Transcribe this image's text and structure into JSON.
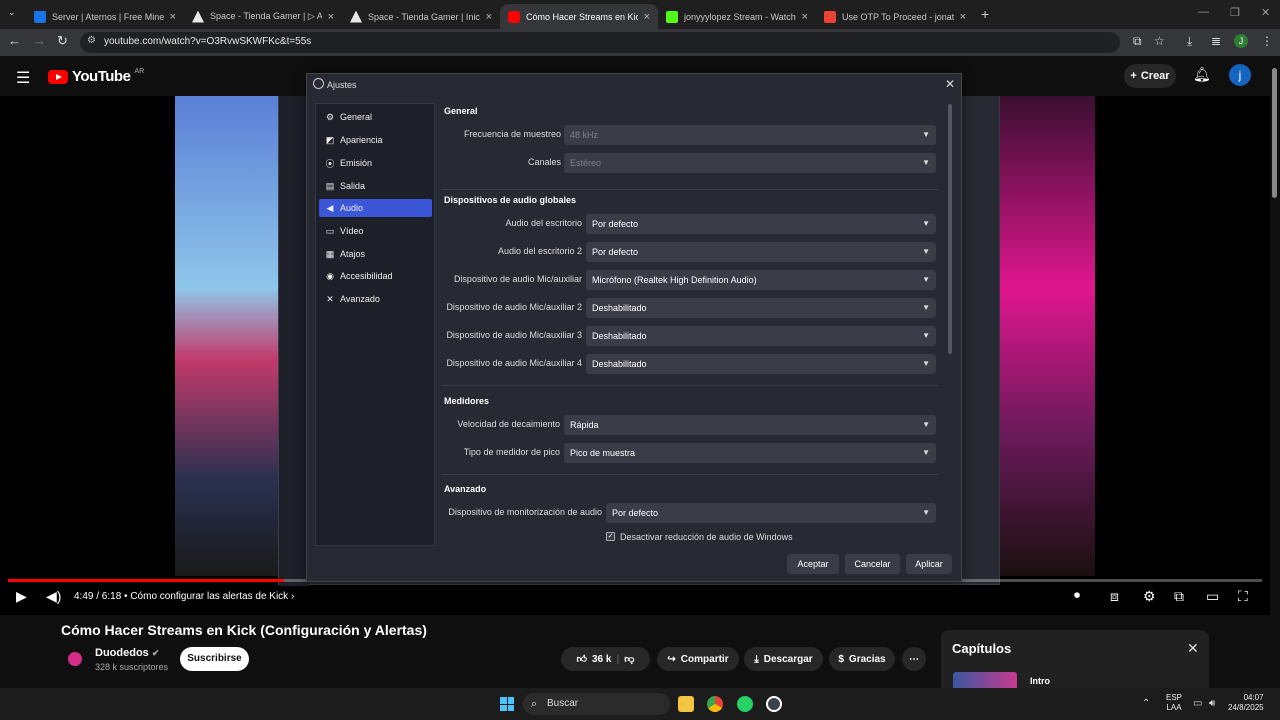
{
  "browser": {
    "tabs": [
      {
        "title": "Server | Aternos | Free Minecraft",
        "fav": "#1a73e8"
      },
      {
        "title": "Space - Tienda Gamer | ▷ Aquí",
        "fav": "#e8e8e8"
      },
      {
        "title": "Space - Tienda Gamer | Inicio",
        "fav": "#e8e8e8"
      },
      {
        "title": "Cómo Hacer Streams en Kick (C",
        "fav": "#ff0000"
      },
      {
        "title": "jonyyylopez Stream - Watch Li",
        "fav": "#53fc18"
      },
      {
        "title": "Use OTP To Proceed - jonathan",
        "fav": "#ea4335"
      }
    ],
    "url": "youtube.com/watch?v=O3RvwSKWFKc&t=55s",
    "profile_initial": "J"
  },
  "youtube": {
    "logo_text": "YouTube",
    "country": "AR",
    "create_label": "Crear",
    "avatar_initial": "j",
    "player": {
      "time": "4:49 / 6:18",
      "chapter": "Cómo configurar las alertas de Kick",
      "chapter_arrow": "›",
      "progress": 0.22
    },
    "video_title": "Cómo Hacer Streams en Kick (Configuración y Alertas)",
    "channel_name": "Duodedos",
    "channel_subs": "328 k suscriptores",
    "subscribe_label": "Suscribirse",
    "likes": "36 k",
    "share_label": "Compartir",
    "download_label": "Descargar",
    "thanks_label": "Gracias",
    "chapters_title": "Capítulos",
    "chapter_first": "Intro"
  },
  "obs_settings": {
    "title": "Ajustes",
    "sidebar": [
      {
        "label": "General",
        "icon": "⚙"
      },
      {
        "label": "Apariencia",
        "icon": "◩"
      },
      {
        "label": "Emisión",
        "icon": "⦿"
      },
      {
        "label": "Salida",
        "icon": "▤"
      },
      {
        "label": "Audio",
        "icon": "◀"
      },
      {
        "label": "Vídeo",
        "icon": "▭"
      },
      {
        "label": "Atajos",
        "icon": "▦"
      },
      {
        "label": "Accesibilidad",
        "icon": "◉"
      },
      {
        "label": "Avanzado",
        "icon": "✕"
      }
    ],
    "general": {
      "heading": "General",
      "sample_rate_label": "Frecuencia de muestreo",
      "sample_rate_value": "48 kHz",
      "channels_label": "Canales",
      "channels_value": "Estéreo"
    },
    "global_devices": {
      "heading": "Dispositivos de audio globales",
      "rows": [
        {
          "label": "Audio del escritorio",
          "value": "Por defecto"
        },
        {
          "label": "Audio del escritorio 2",
          "value": "Por defecto"
        },
        {
          "label": "Dispositivo de audio Mic/auxiliar",
          "value": "Micrófono (Realtek High Definition Audio)"
        },
        {
          "label": "Dispositivo de audio Mic/auxiliar 2",
          "value": "Deshabilitado"
        },
        {
          "label": "Dispositivo de audio Mic/auxiliar 3",
          "value": "Deshabilitado"
        },
        {
          "label": "Dispositivo de audio Mic/auxiliar 4",
          "value": "Deshabilitado"
        }
      ]
    },
    "meters": {
      "heading": "Medidores",
      "decay_label": "Velocidad de decaimiento",
      "decay_value": "Rápida",
      "peak_label": "Tipo de medidor de pico",
      "peak_value": "Pico de muestra"
    },
    "advanced": {
      "heading": "Avanzado",
      "monitor_label": "Dispositivo de monitorización de audio",
      "monitor_value": "Por defecto",
      "ducking_label": "Desactivar reducción de audio de Windows",
      "ducking_checked": true
    },
    "buttons": {
      "accept": "Aceptar",
      "cancel": "Cancelar",
      "apply": "Aplicar"
    }
  },
  "taskbar": {
    "search": "Buscar",
    "lang1": "ESP",
    "lang2": "LAA",
    "time": "04:07",
    "date": "24/8/2025"
  }
}
